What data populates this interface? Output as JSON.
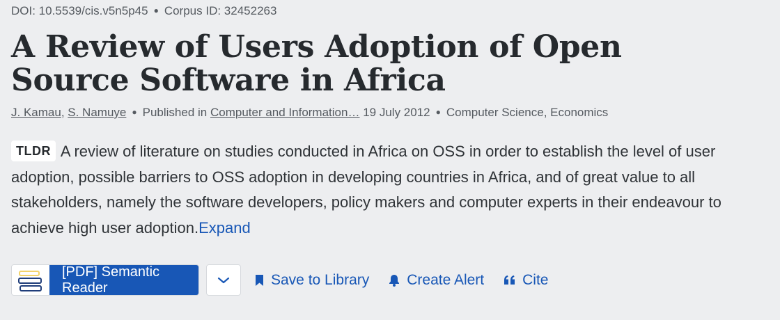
{
  "meta": {
    "doi": "DOI: 10.5539/cis.v5n5p45",
    "corpus_id": "Corpus ID: 32452263"
  },
  "paper": {
    "title": "A Review of Users Adoption of Open Source Software in Africa",
    "authors": [
      "J. Kamau",
      "S. Namuye"
    ],
    "published_prefix": "Published in",
    "venue": "Computer and Information…",
    "date": "19 July 2012",
    "fields": "Computer Science, Economics"
  },
  "tldr": {
    "badge": "TLDR",
    "text": "A review of literature on studies conducted in Africa on OSS in order to establish the level of user adoption, possible barriers to OSS adoption in developing countries in Africa, and of great value to all stakeholders, namely the software developers, policy makers and computer experts in their endeavour to achieve high user adoption.",
    "expand_label": "Expand"
  },
  "actions": {
    "reader_label": "[PDF] Semantic Reader",
    "save_label": "Save to Library",
    "alert_label": "Create Alert",
    "cite_label": "Cite"
  },
  "colors": {
    "accent": "#1857b6",
    "background": "#edeef0",
    "text": "#2f3337"
  }
}
